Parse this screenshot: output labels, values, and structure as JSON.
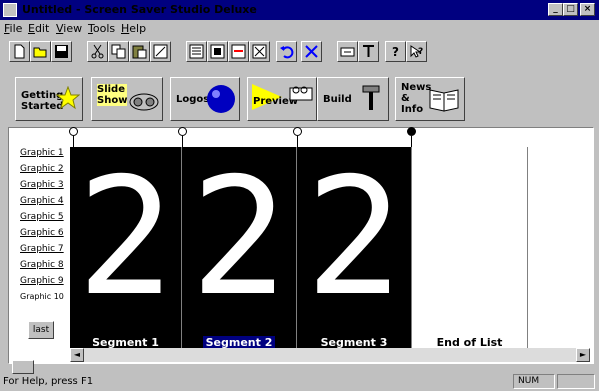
{
  "window": {
    "title": "Untitled - Screen Saver Studio Deluxe"
  },
  "menu": [
    {
      "label": "File",
      "u": "F",
      "rest": "ile"
    },
    {
      "label": "Edit",
      "u": "E",
      "rest": "dit"
    },
    {
      "label": "View",
      "u": "V",
      "rest": "iew"
    },
    {
      "label": "Tools",
      "u": "T",
      "rest": "ools"
    },
    {
      "label": "Help",
      "u": "H",
      "rest": "elp"
    }
  ],
  "toolbar": {
    "icons": [
      "new-file-icon",
      "open-folder-icon",
      "save-icon",
      "cut-icon",
      "copy-icon",
      "paste-icon",
      "properties-icon",
      "align-icon",
      "frame-icon",
      "resize-icon",
      "stretch-icon",
      "undo-icon",
      "delete-icon",
      "text-box-icon",
      "text-tool-icon",
      "help-icon",
      "context-help-icon"
    ]
  },
  "big_buttons": {
    "getting_started": "Getting\nStarted",
    "slide_show": "Slide\nShow",
    "logos": "Logos",
    "preview": "Preview",
    "build": "Build",
    "news_info": "News\n&\nInfo"
  },
  "graphics": [
    "Graphic 1",
    "Graphic 2",
    "Graphic 3",
    "Graphic 4",
    "Graphic 5",
    "Graphic 6",
    "Graphic 7",
    "Graphic 8",
    "Graphic 9",
    "Graphic 10"
  ],
  "last_button": "last",
  "segments": [
    {
      "label": "Segment 1",
      "digit": "2",
      "selected": false
    },
    {
      "label": "Segment 2",
      "digit": "2",
      "selected": true
    },
    {
      "label": "Segment 3",
      "digit": "2",
      "selected": false
    }
  ],
  "end_of_list": "End of List",
  "status": {
    "help": "For Help, press F1",
    "num": "NUM"
  },
  "colors": {
    "title_bar": "#000080",
    "face": "#c0c0c0",
    "segment_bg": "#000000",
    "selected_label": "#000080"
  }
}
